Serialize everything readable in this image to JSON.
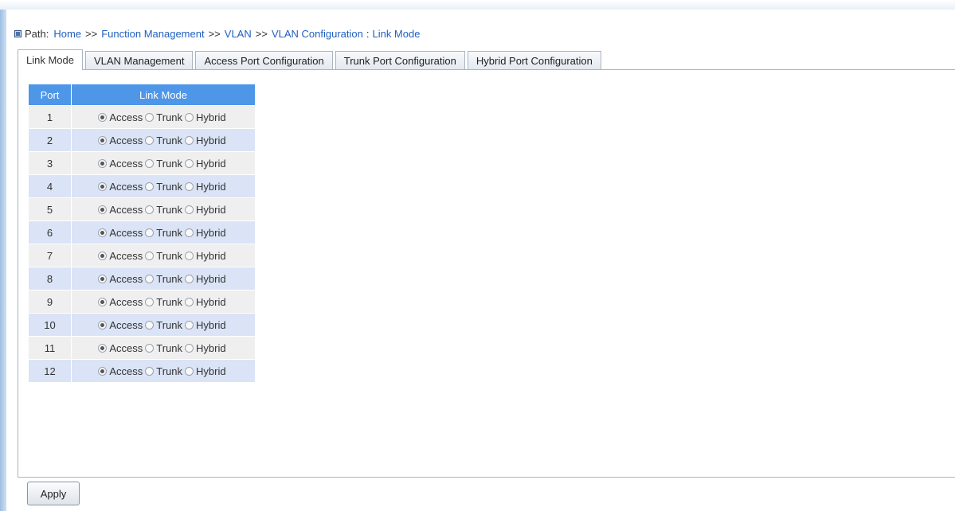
{
  "breadcrumb": {
    "label": "Path:",
    "items": [
      "Home",
      "Function Management",
      "VLAN",
      "VLAN Configuration"
    ],
    "separator": ">>",
    "current": "Link Mode"
  },
  "tabs": [
    {
      "label": "Link Mode",
      "active": true
    },
    {
      "label": "VLAN Management",
      "active": false
    },
    {
      "label": "Access Port Configuration",
      "active": false
    },
    {
      "label": "Trunk Port Configuration",
      "active": false
    },
    {
      "label": "Hybrid Port Configuration",
      "active": false
    }
  ],
  "table": {
    "headers": {
      "port": "Port",
      "mode": "Link Mode"
    },
    "options": [
      "Access",
      "Trunk",
      "Hybrid"
    ],
    "rows": [
      {
        "port": "1",
        "mode": "Access"
      },
      {
        "port": "2",
        "mode": "Access"
      },
      {
        "port": "3",
        "mode": "Access"
      },
      {
        "port": "4",
        "mode": "Access"
      },
      {
        "port": "5",
        "mode": "Access"
      },
      {
        "port": "6",
        "mode": "Access"
      },
      {
        "port": "7",
        "mode": "Access"
      },
      {
        "port": "8",
        "mode": "Access"
      },
      {
        "port": "9",
        "mode": "Access"
      },
      {
        "port": "10",
        "mode": "Access"
      },
      {
        "port": "11",
        "mode": "Access"
      },
      {
        "port": "12",
        "mode": "Access"
      }
    ]
  },
  "apply_label": "Apply",
  "colors": {
    "header_bg": "#4e96e8",
    "row_odd": "#efefef",
    "row_even": "#dae4f6",
    "link": "#1f5fbf"
  }
}
